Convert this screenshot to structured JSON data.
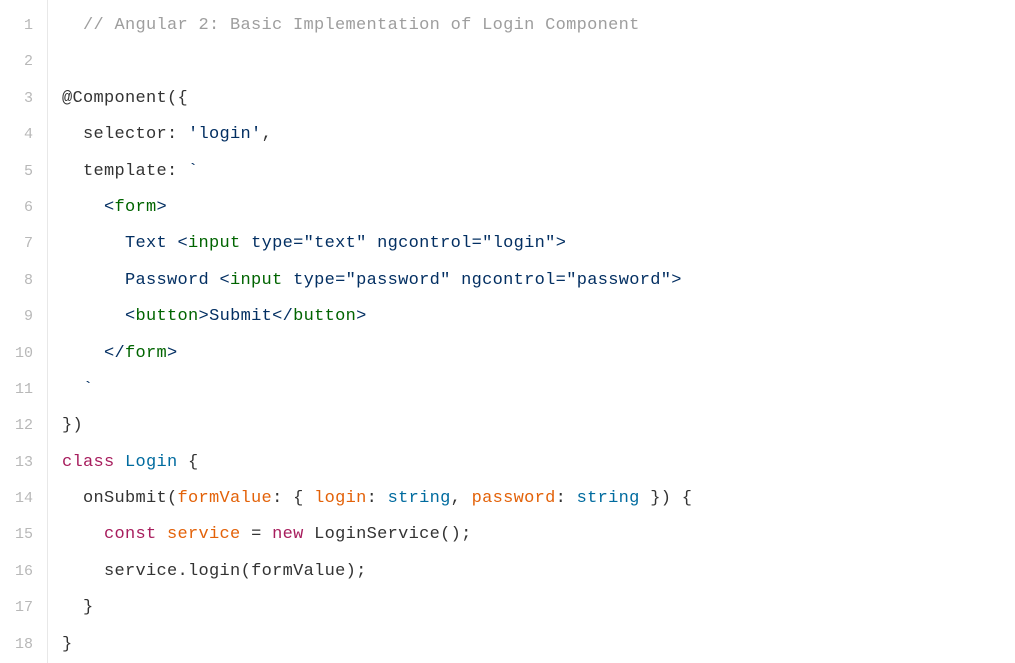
{
  "lines": [
    {
      "num": 1,
      "indent": 2,
      "tokens": [
        {
          "t": "// Angular 2: Basic Implementation of Login Component",
          "c": "tok-comment"
        }
      ]
    },
    {
      "num": 2,
      "indent": 0,
      "tokens": []
    },
    {
      "num": 3,
      "indent": 0,
      "tokens": [
        {
          "t": "@Component",
          "c": "tok-decor"
        },
        {
          "t": "({",
          "c": "tok-punct"
        }
      ]
    },
    {
      "num": 4,
      "indent": 2,
      "tokens": [
        {
          "t": "selector",
          "c": "tok-prop"
        },
        {
          "t": ": ",
          "c": "tok-punct"
        },
        {
          "t": "'login'",
          "c": "tok-string"
        },
        {
          "t": ",",
          "c": "tok-punct"
        }
      ]
    },
    {
      "num": 5,
      "indent": 2,
      "tokens": [
        {
          "t": "template",
          "c": "tok-prop"
        },
        {
          "t": ": ",
          "c": "tok-punct"
        },
        {
          "t": "`",
          "c": "tok-string"
        }
      ]
    },
    {
      "num": 6,
      "indent": 4,
      "tokens": [
        {
          "t": "<",
          "c": "tok-tagpunct"
        },
        {
          "t": "form",
          "c": "tok-tag"
        },
        {
          "t": ">",
          "c": "tok-tagpunct"
        }
      ]
    },
    {
      "num": 7,
      "indent": 6,
      "tokens": [
        {
          "t": "Text ",
          "c": "tok-string"
        },
        {
          "t": "<",
          "c": "tok-tagpunct"
        },
        {
          "t": "input",
          "c": "tok-tag"
        },
        {
          "t": " ",
          "c": ""
        },
        {
          "t": "type",
          "c": "tok-attr"
        },
        {
          "t": "=",
          "c": "tok-tagpunct"
        },
        {
          "t": "\"text\"",
          "c": "tok-attrval"
        },
        {
          "t": " ",
          "c": ""
        },
        {
          "t": "ngcontrol",
          "c": "tok-attr"
        },
        {
          "t": "=",
          "c": "tok-tagpunct"
        },
        {
          "t": "\"login\"",
          "c": "tok-attrval"
        },
        {
          "t": ">",
          "c": "tok-tagpunct"
        }
      ]
    },
    {
      "num": 8,
      "indent": 6,
      "tokens": [
        {
          "t": "Password ",
          "c": "tok-string"
        },
        {
          "t": "<",
          "c": "tok-tagpunct"
        },
        {
          "t": "input",
          "c": "tok-tag"
        },
        {
          "t": " ",
          "c": ""
        },
        {
          "t": "type",
          "c": "tok-attr"
        },
        {
          "t": "=",
          "c": "tok-tagpunct"
        },
        {
          "t": "\"password\"",
          "c": "tok-attrval"
        },
        {
          "t": " ",
          "c": ""
        },
        {
          "t": "ngcontrol",
          "c": "tok-attr"
        },
        {
          "t": "=",
          "c": "tok-tagpunct"
        },
        {
          "t": "\"password\"",
          "c": "tok-attrval"
        },
        {
          "t": ">",
          "c": "tok-tagpunct"
        }
      ]
    },
    {
      "num": 9,
      "indent": 6,
      "tokens": [
        {
          "t": "<",
          "c": "tok-tagpunct"
        },
        {
          "t": "button",
          "c": "tok-tag"
        },
        {
          "t": ">",
          "c": "tok-tagpunct"
        },
        {
          "t": "Submit",
          "c": "tok-string"
        },
        {
          "t": "</",
          "c": "tok-tagpunct"
        },
        {
          "t": "button",
          "c": "tok-tag"
        },
        {
          "t": ">",
          "c": "tok-tagpunct"
        }
      ]
    },
    {
      "num": 10,
      "indent": 4,
      "tokens": [
        {
          "t": "</",
          "c": "tok-tagpunct"
        },
        {
          "t": "form",
          "c": "tok-tag"
        },
        {
          "t": ">",
          "c": "tok-tagpunct"
        }
      ]
    },
    {
      "num": 11,
      "indent": 2,
      "tokens": [
        {
          "t": "`",
          "c": "tok-string"
        }
      ]
    },
    {
      "num": 12,
      "indent": 0,
      "tokens": [
        {
          "t": "})",
          "c": "tok-punct"
        }
      ]
    },
    {
      "num": 13,
      "indent": 0,
      "tokens": [
        {
          "t": "class",
          "c": "tok-keyword"
        },
        {
          "t": " ",
          "c": ""
        },
        {
          "t": "Login",
          "c": "tok-class"
        },
        {
          "t": " {",
          "c": "tok-punct"
        }
      ]
    },
    {
      "num": 14,
      "indent": 2,
      "tokens": [
        {
          "t": "onSubmit",
          "c": "tok-method"
        },
        {
          "t": "(",
          "c": "tok-punct"
        },
        {
          "t": "formValue",
          "c": "tok-param"
        },
        {
          "t": ": { ",
          "c": "tok-punct"
        },
        {
          "t": "login",
          "c": "tok-param"
        },
        {
          "t": ": ",
          "c": "tok-punct"
        },
        {
          "t": "string",
          "c": "tok-type"
        },
        {
          "t": ", ",
          "c": "tok-punct"
        },
        {
          "t": "password",
          "c": "tok-param"
        },
        {
          "t": ": ",
          "c": "tok-punct"
        },
        {
          "t": "string",
          "c": "tok-type"
        },
        {
          "t": " }) {",
          "c": "tok-punct"
        }
      ]
    },
    {
      "num": 15,
      "indent": 4,
      "tokens": [
        {
          "t": "const",
          "c": "tok-keyword"
        },
        {
          "t": " ",
          "c": ""
        },
        {
          "t": "service",
          "c": "tok-var"
        },
        {
          "t": " = ",
          "c": "tok-punct"
        },
        {
          "t": "new",
          "c": "tok-keyword"
        },
        {
          "t": " ",
          "c": ""
        },
        {
          "t": "LoginService",
          "c": "tok-call"
        },
        {
          "t": "();",
          "c": "tok-punct"
        }
      ]
    },
    {
      "num": 16,
      "indent": 4,
      "tokens": [
        {
          "t": "service",
          "c": "tok-call"
        },
        {
          "t": ".",
          "c": "tok-punct"
        },
        {
          "t": "login",
          "c": "tok-call"
        },
        {
          "t": "(",
          "c": "tok-punct"
        },
        {
          "t": "formValue",
          "c": "tok-call"
        },
        {
          "t": ");",
          "c": "tok-punct"
        }
      ]
    },
    {
      "num": 17,
      "indent": 2,
      "tokens": [
        {
          "t": "}",
          "c": "tok-punct"
        }
      ]
    },
    {
      "num": 18,
      "indent": 0,
      "tokens": [
        {
          "t": "}",
          "c": "tok-punct"
        }
      ]
    }
  ]
}
